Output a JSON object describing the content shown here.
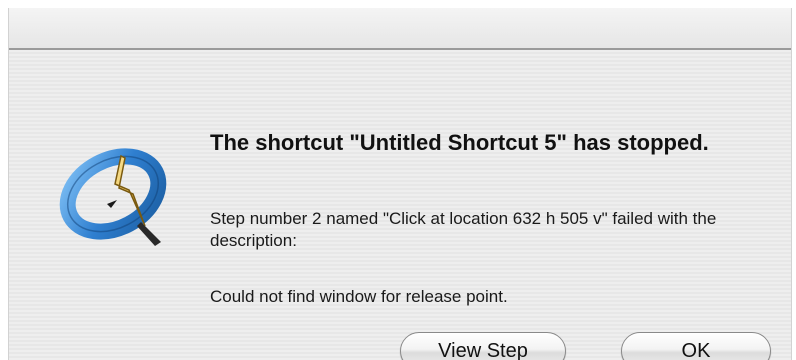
{
  "dialog": {
    "title": "The shortcut \"Untitled Shortcut 5\" has stopped.",
    "detail": "Step number 2 named \"Click at location 632 h 505 v\" failed with the description:",
    "reason": "Could not find window for release point.",
    "icon": "quickeys-q-icon"
  },
  "buttons": {
    "view_step": "View Step",
    "ok": "OK"
  },
  "colors": {
    "icon_ring": "#2f7fd0",
    "icon_ring_dark": "#1c5fa3",
    "icon_accent": "#f2c14a",
    "background": "#ececec"
  }
}
